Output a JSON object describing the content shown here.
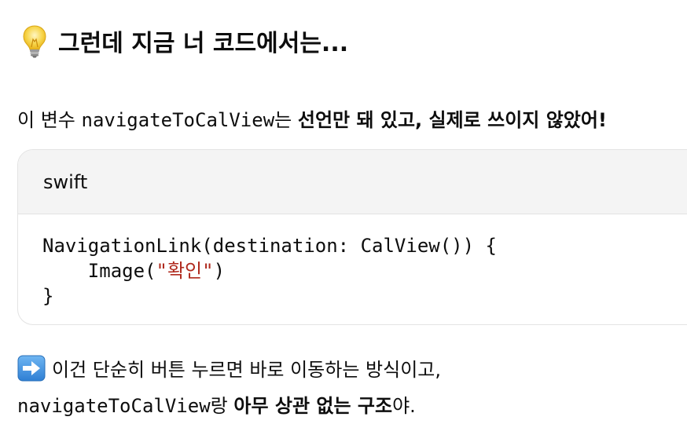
{
  "heading": {
    "icon": "lightbulb-icon",
    "text": "그런데 지금 너 코드에서는..."
  },
  "paragraph1": {
    "prefix": "이 변수 ",
    "variable": "navigateToCalView",
    "particle": "는 ",
    "emphasis": "선언만 돼 있고, 실제로 쓰이지 않았어!"
  },
  "code_block": {
    "language": "swift",
    "line1": "NavigationLink(destination: CalView()) {",
    "line2_prefix": "    Image(",
    "line2_string": "\"확인\"",
    "line2_suffix": ")",
    "line3": "}"
  },
  "paragraph2": {
    "icon": "right-arrow-icon",
    "line1": "이건 단순히 버튼 누르면 바로 이동하는 방식이고,",
    "variable": "navigateToCalView",
    "particle": "랑 ",
    "emphasis": "아무 상관 없는 구조",
    "suffix": "야."
  },
  "colors": {
    "text": "#0d0d0d",
    "code_header_bg": "#f4f4f4",
    "code_border": "#e3e3e3",
    "string_literal": "#b02a1e",
    "arrow_icon_bg": "#3d8fe0"
  }
}
